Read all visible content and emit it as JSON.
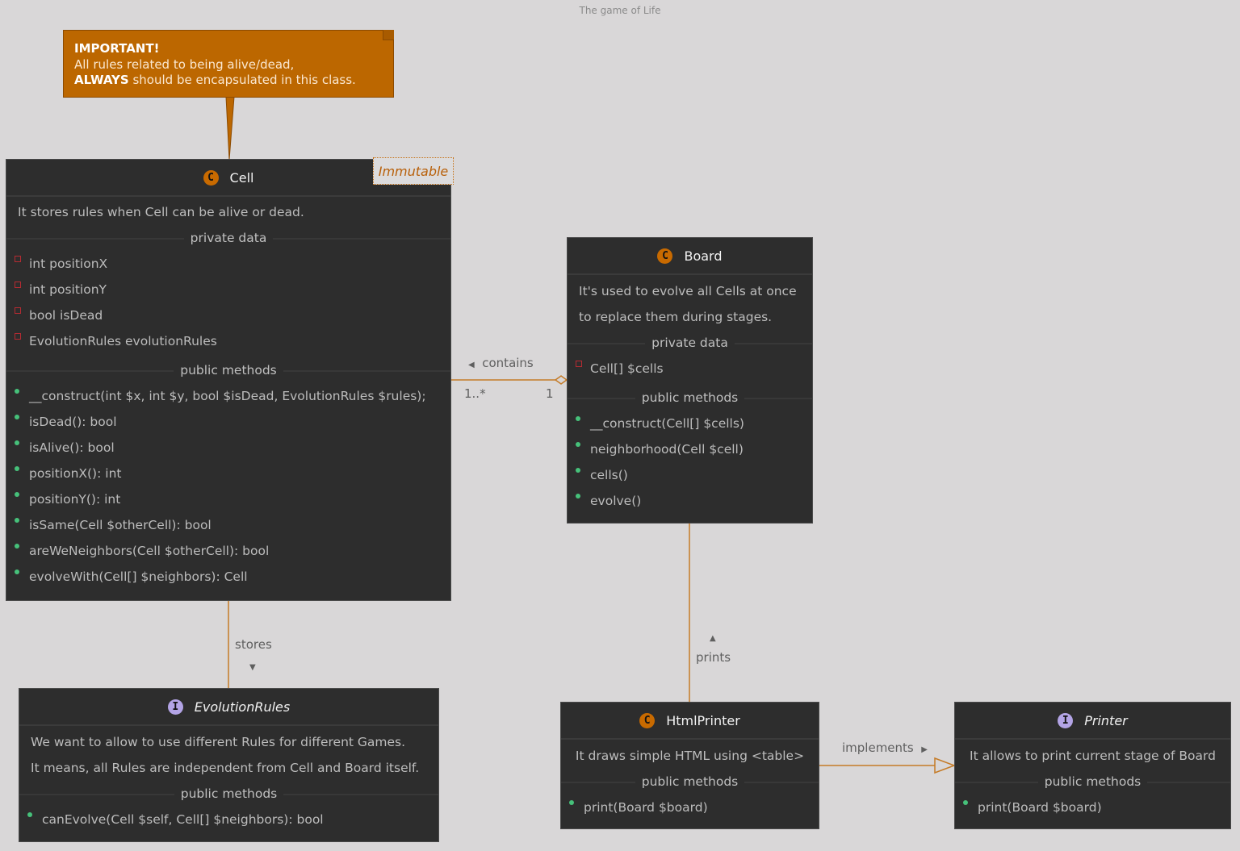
{
  "diagram_title": "The game of Life",
  "note": {
    "line1": "IMPORTANT!",
    "line2": "All rules related to being alive/dead,",
    "line3_bold": "ALWAYS",
    "line3_rest": " should be encapsulated in this class.",
    "fill_color": "#bc6700"
  },
  "classes": {
    "cell": {
      "kind": "class",
      "icon": "C",
      "name": "Cell",
      "stereotype_tag": "Immutable",
      "description": [
        "It stores rules when Cell can be alive or dead."
      ],
      "private_label": "private data",
      "private": [
        "int positionX",
        "int positionY",
        "bool isDead",
        "EvolutionRules evolutionRules"
      ],
      "public_label": "public methods",
      "public": [
        "__construct(int $x, int $y, bool $isDead, EvolutionRules $rules);",
        "isDead(): bool",
        "isAlive(): bool",
        "positionX(): int",
        "positionY(): int",
        "isSame(Cell $otherCell): bool",
        "areWeNeighbors(Cell $otherCell): bool",
        "evolveWith(Cell[] $neighbors): Cell"
      ]
    },
    "board": {
      "kind": "class",
      "icon": "C",
      "name": "Board",
      "description": [
        "It's used to evolve all Cells at once",
        "to replace them during stages."
      ],
      "private_label": "private data",
      "private": [
        "Cell[] $cells"
      ],
      "public_label": "public methods",
      "public": [
        "__construct(Cell[] $cells)",
        "neighborhood(Cell $cell)",
        "cells()",
        "evolve()"
      ]
    },
    "evolution_rules": {
      "kind": "interface",
      "icon": "I",
      "name": "EvolutionRules",
      "description": [
        "We want to allow to use different Rules for different Games.",
        "It means, all Rules are independent from Cell and Board itself."
      ],
      "public_label": "public methods",
      "public": [
        "canEvolve(Cell $self, Cell[] $neighbors): bool"
      ]
    },
    "html_printer": {
      "kind": "class",
      "icon": "C",
      "name": "HtmlPrinter",
      "description": [
        "It draws simple HTML using <table>"
      ],
      "public_label": "public methods",
      "public": [
        "print(Board $board)"
      ]
    },
    "printer": {
      "kind": "interface",
      "icon": "I",
      "name": "Printer",
      "description": [
        "It allows to print current stage of Board"
      ],
      "public_label": "public methods",
      "public": [
        "print(Board $board)"
      ]
    }
  },
  "relations": {
    "contains": {
      "label": "contains",
      "direction_arrow": "◀",
      "from": "Board",
      "to": "Cell",
      "type": "aggregation",
      "mult_cell": "1..*",
      "mult_board": "1"
    },
    "stores": {
      "label": "stores",
      "direction_arrow": "▼",
      "from": "Cell",
      "to": "EvolutionRules",
      "type": "association"
    },
    "prints": {
      "label": "prints",
      "direction_arrow": "▲",
      "from": "HtmlPrinter",
      "to": "Board",
      "type": "association"
    },
    "implements": {
      "label": "implements",
      "direction_arrow": "▶",
      "from": "HtmlPrinter",
      "to": "Printer",
      "type": "realization"
    }
  },
  "colors": {
    "background": "#d9d7d8",
    "class_fill": "#2d2d2d",
    "link": "#c57b27",
    "class_icon": "#c86a00",
    "interface_icon": "#b3a4e6",
    "private_marker": "#b52b32",
    "public_marker": "#46c17a"
  }
}
